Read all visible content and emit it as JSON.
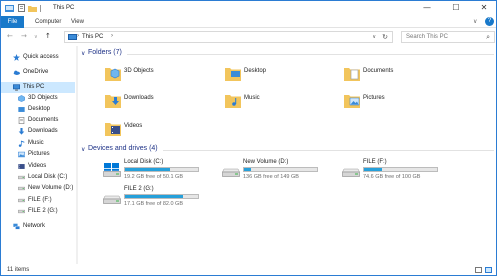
{
  "window": {
    "title": "This PC",
    "controls": {
      "minimize": "—",
      "maximize": "☐",
      "close": "✕"
    }
  },
  "ribbon": {
    "tabs": [
      "File",
      "Computer",
      "View"
    ],
    "collapse_glyph": "∨",
    "help_glyph": "?"
  },
  "address": {
    "back": "←",
    "forward": "→",
    "recent": "∨",
    "up": "↑",
    "path": [
      "This PC"
    ],
    "chevron": "›",
    "dropdown": "∨",
    "refresh": "↻"
  },
  "search": {
    "placeholder": "Search This PC",
    "icon": "search-icon"
  },
  "sidebar": {
    "items": [
      {
        "label": "Quick access",
        "icon": "star-icon",
        "level": 0,
        "selected": false
      },
      {
        "label": "OneDrive",
        "icon": "cloud-icon",
        "level": 0,
        "selected": false
      },
      {
        "label": "This PC",
        "icon": "computer-icon",
        "level": 0,
        "selected": true
      },
      {
        "label": "3D Objects",
        "icon": "3d-objects-icon",
        "level": 1,
        "selected": false
      },
      {
        "label": "Desktop",
        "icon": "desktop-icon",
        "level": 1,
        "selected": false
      },
      {
        "label": "Documents",
        "icon": "documents-icon",
        "level": 1,
        "selected": false
      },
      {
        "label": "Downloads",
        "icon": "downloads-icon",
        "level": 1,
        "selected": false
      },
      {
        "label": "Music",
        "icon": "music-icon",
        "level": 1,
        "selected": false
      },
      {
        "label": "Pictures",
        "icon": "pictures-icon",
        "level": 1,
        "selected": false
      },
      {
        "label": "Videos",
        "icon": "videos-icon",
        "level": 1,
        "selected": false
      },
      {
        "label": "Local Disk (C:)",
        "icon": "drive-icon",
        "level": 1,
        "selected": false
      },
      {
        "label": "New Volume (D:)",
        "icon": "drive-icon",
        "level": 1,
        "selected": false
      },
      {
        "label": "FILE (F:)",
        "icon": "drive-icon",
        "level": 1,
        "selected": false
      },
      {
        "label": "FILE 2 (G:)",
        "icon": "drive-icon",
        "level": 1,
        "selected": false
      },
      {
        "label": "Network",
        "icon": "network-icon",
        "level": 0,
        "selected": false
      }
    ]
  },
  "folders_group": {
    "title": "Folders (7)",
    "items": [
      {
        "label": "3D Objects",
        "icon": "3d-objects-folder-icon"
      },
      {
        "label": "Desktop",
        "icon": "desktop-folder-icon"
      },
      {
        "label": "Documents",
        "icon": "documents-folder-icon"
      },
      {
        "label": "Downloads",
        "icon": "downloads-folder-icon"
      },
      {
        "label": "Music",
        "icon": "music-folder-icon"
      },
      {
        "label": "Pictures",
        "icon": "pictures-folder-icon"
      },
      {
        "label": "Videos",
        "icon": "videos-folder-icon"
      }
    ]
  },
  "drives_group": {
    "title": "Devices and drives (4)",
    "items": [
      {
        "label": "Local Disk (C:)",
        "space": "19.2 GB free of 50.1 GB",
        "used_fraction": 0.62,
        "icon": "windows-drive-icon"
      },
      {
        "label": "New Volume (D:)",
        "space": "136 GB free of 149 GB",
        "used_fraction": 0.09,
        "icon": "drive-icon"
      },
      {
        "label": "FILE (F:)",
        "space": "74.6 GB free of 100 GB",
        "used_fraction": 0.25,
        "icon": "drive-icon"
      },
      {
        "label": "FILE 2 (G:)",
        "space": "17.1 GB free of 82.0 GB",
        "used_fraction": 0.79,
        "icon": "drive-icon"
      }
    ]
  },
  "status": {
    "text": "11 items"
  },
  "colors": {
    "accent": "#1979ca",
    "selection": "#cce8ff",
    "folder": "#f2c55c",
    "bar_fill": "#26a0da",
    "group_title": "#1e3287"
  }
}
